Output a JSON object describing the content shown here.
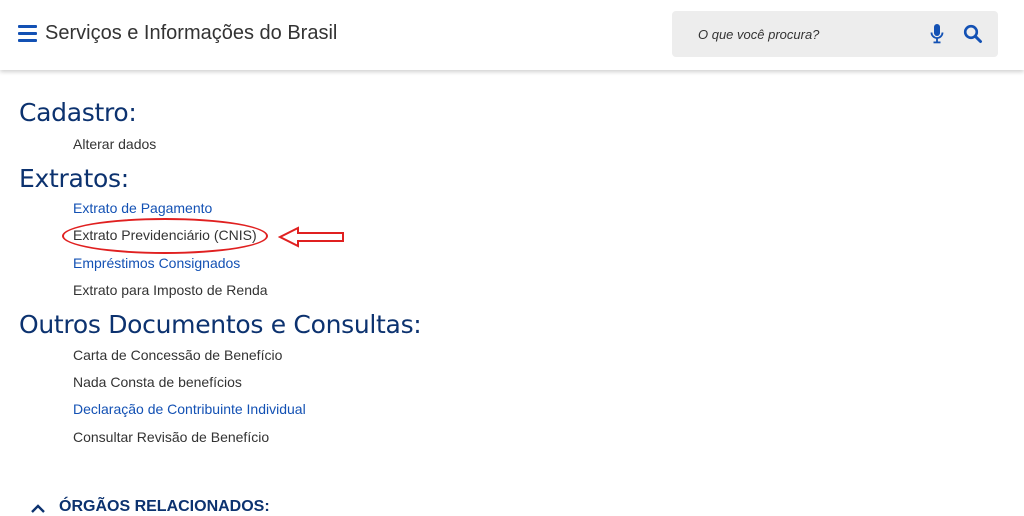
{
  "header": {
    "menu_icon": "hamburger-menu-icon",
    "title": "Serviços e Informações do Brasil",
    "search": {
      "placeholder": "O que você procura?",
      "mic_icon": "microphone-icon",
      "search_icon": "magnifier-icon"
    }
  },
  "sections": {
    "cadastro": {
      "title": "Cadastro:",
      "items": [
        "Alterar dados"
      ]
    },
    "extratos": {
      "title": "Extratos:",
      "items": [
        "Extrato de Pagamento",
        "Extrato Previdenciário (CNIS)",
        "Empréstimos Consignados",
        "Extrato para Imposto de Renda"
      ]
    },
    "outros": {
      "title": "Outros Documentos e Consultas:",
      "items": [
        "Carta de Concessão de Benefício",
        "Nada Consta de benefícios",
        "Declaração de Contribuinte Individual",
        "Consultar Revisão de Benefício"
      ]
    }
  },
  "related": {
    "label": "ÓRGÃOS RELACIONADOS:",
    "icon": "chevron-up-icon"
  },
  "annotation": {
    "color": "#e02020",
    "highlighted_item": "Extrato Previdenciário (CNIS)"
  },
  "colors": {
    "heading": "#0c326f",
    "link_blue": "#1351b4",
    "text_dark": "#333333",
    "search_bg": "#ededed"
  }
}
